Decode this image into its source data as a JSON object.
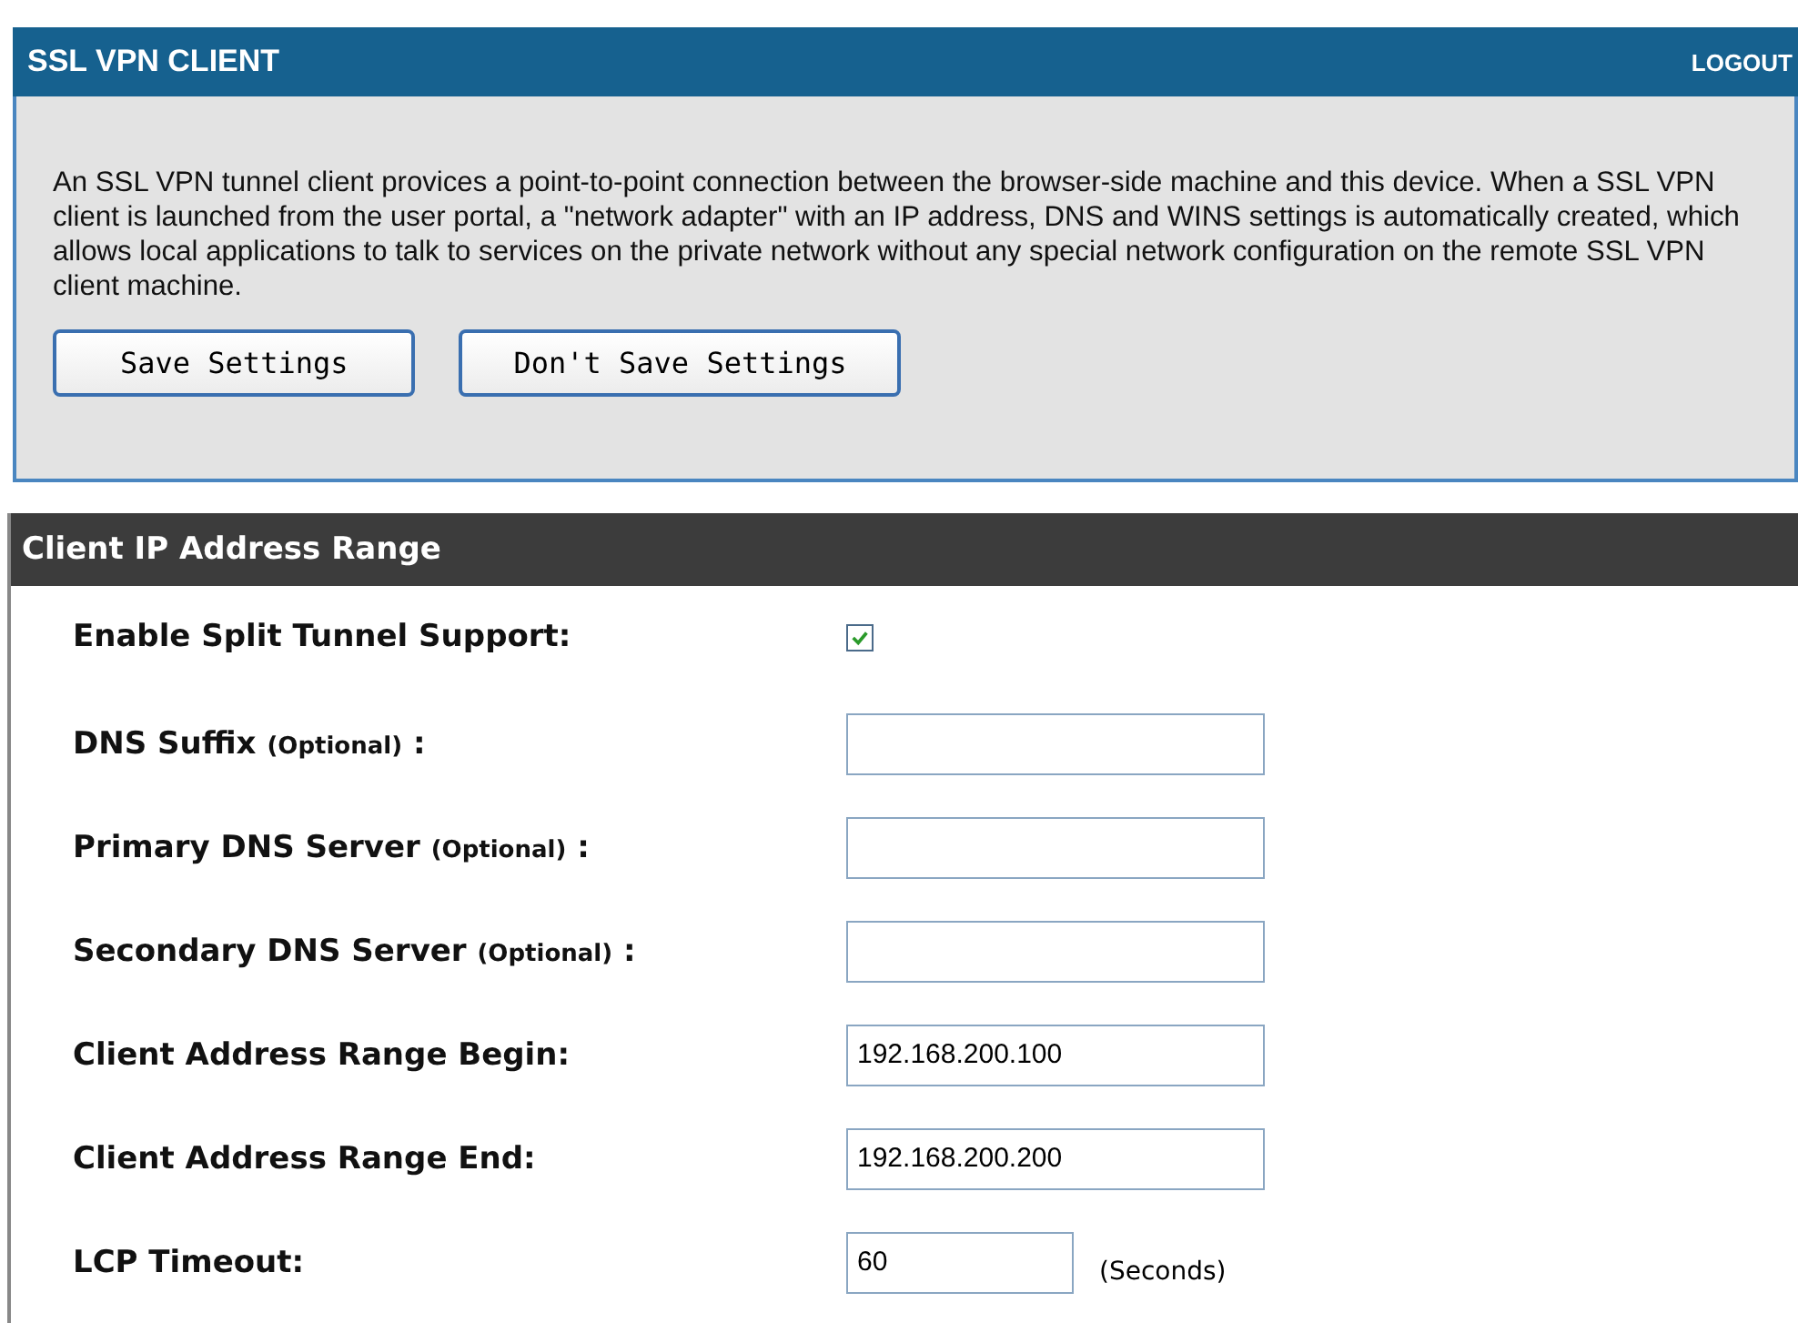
{
  "header": {
    "title": "SSL VPN CLIENT",
    "logout": "LOGOUT"
  },
  "intro": {
    "text": "An SSL VPN tunnel client provices a point-to-point connection between the browser-side machine and this device. When a SSL VPN client is launched from the user portal, a \"network adapter\" with an IP address, DNS and WINS settings is automatically created, which allows local applications to talk to services on the private network without any special network configuration on the remote SSL VPN client machine.",
    "buttons": [
      "Save Settings",
      "Don't Save Settings"
    ]
  },
  "section": {
    "title": "Client IP Address Range",
    "rows": [
      {
        "kind": "checkbox",
        "label": "Enable Split Tunnel Support:",
        "checked": true
      },
      {
        "kind": "field",
        "label": "DNS Suffix",
        "note": "(Optional)",
        "suffix": ":"
      },
      {
        "kind": "field",
        "label": "Primary DNS Server",
        "note": "(Optional)",
        "suffix": ":"
      },
      {
        "kind": "field",
        "label": "Secondary DNS Server",
        "note": "(Optional)",
        "suffix": ":"
      },
      {
        "kind": "field",
        "label": "Client Address Range Begin:",
        "value": "192.168.200.100"
      },
      {
        "kind": "field",
        "label": "Client Address Range End:",
        "value": "192.168.200.200"
      },
      {
        "kind": "short",
        "label": "LCP Timeout:",
        "value": "60",
        "unit": "(Seconds)"
      }
    ]
  }
}
